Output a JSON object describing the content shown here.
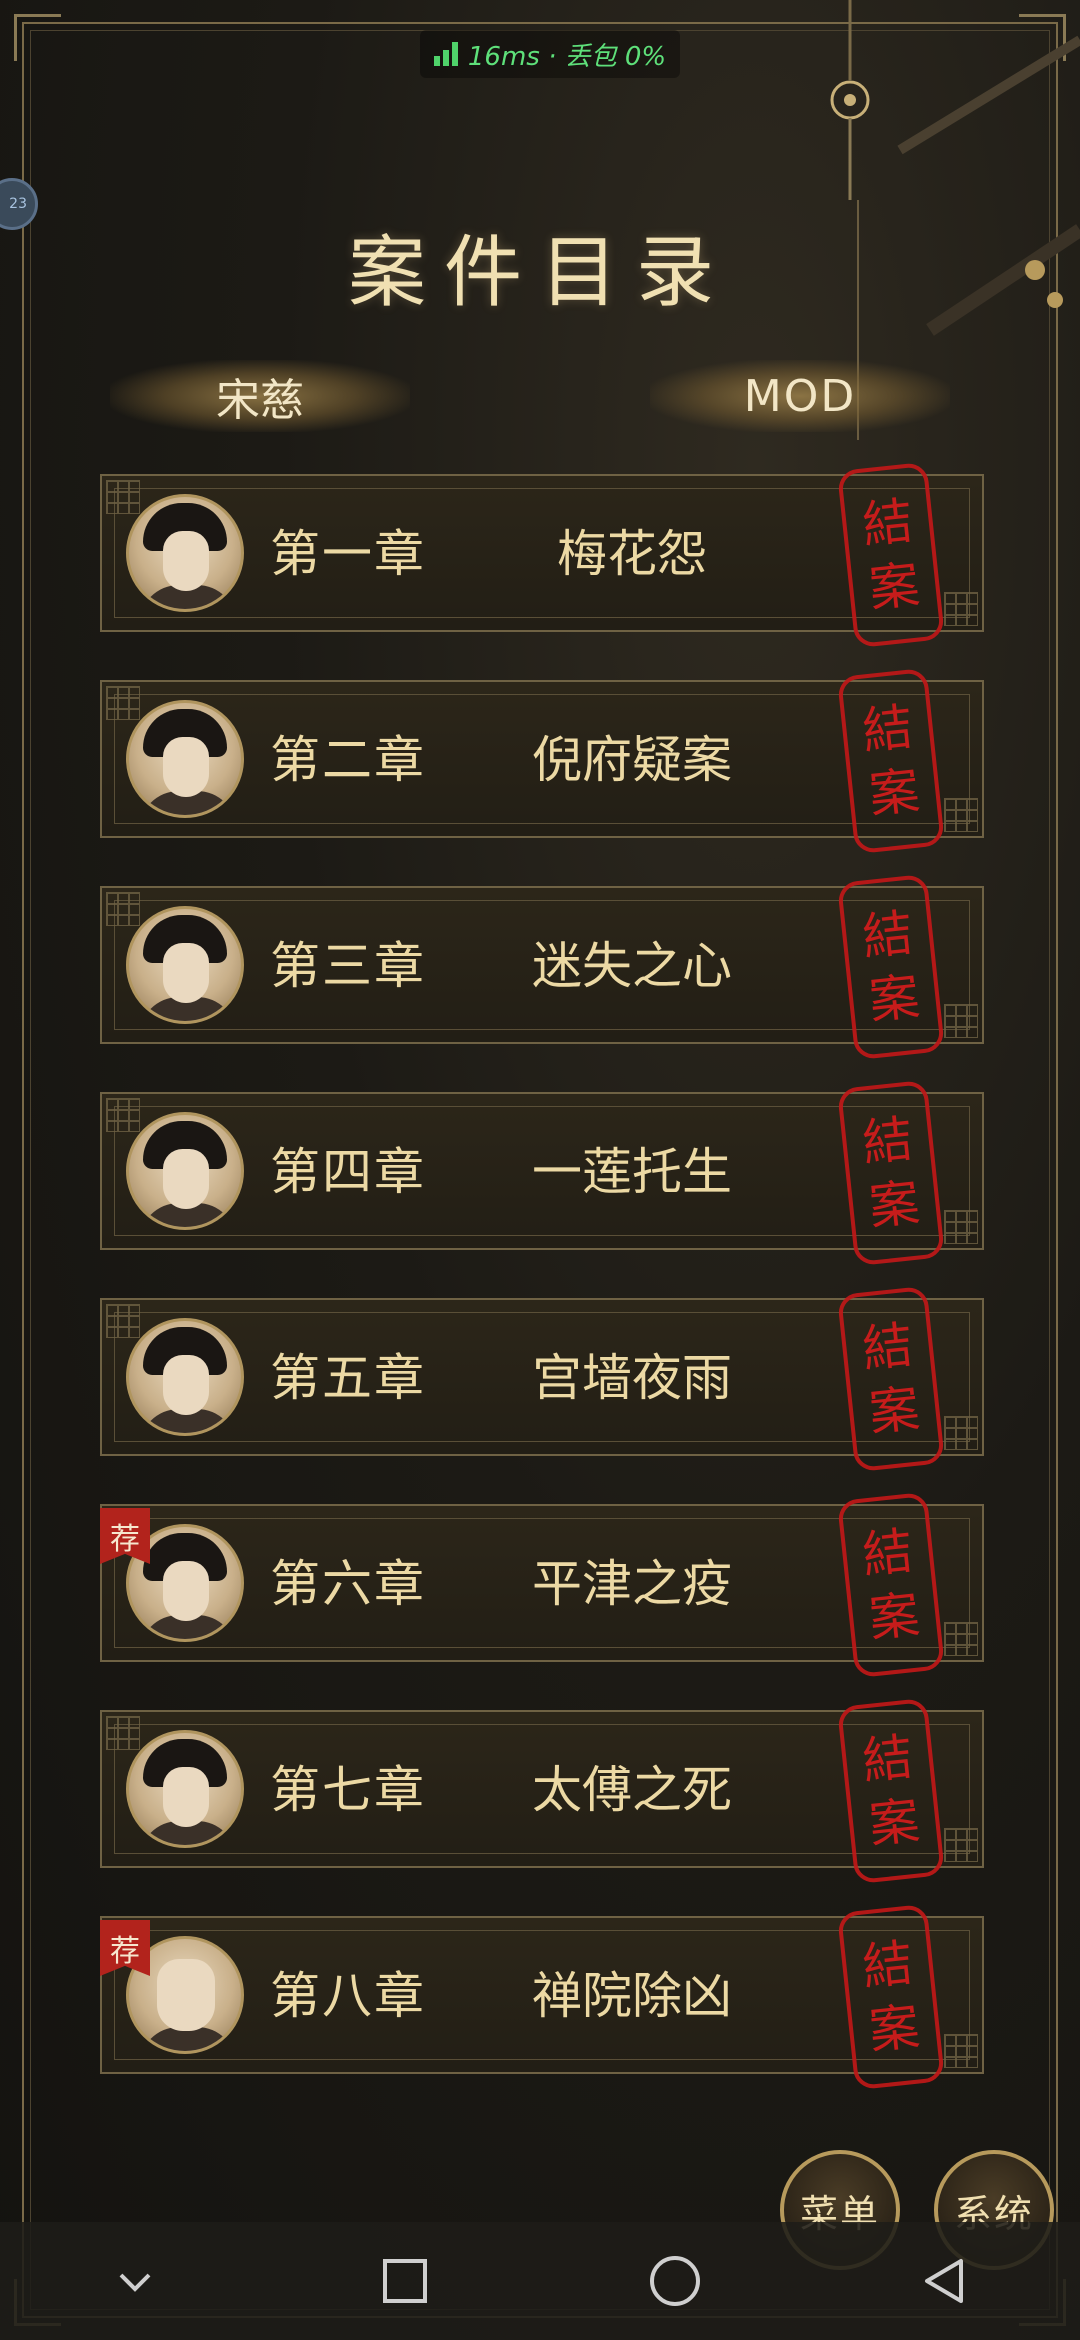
{
  "status": {
    "ping_text": "16ms · 丢包 0%",
    "ping_color": "#5ee07a"
  },
  "title": "案件目录",
  "tabs": [
    {
      "label": "宋慈"
    },
    {
      "label": "MOD"
    }
  ],
  "chapters": [
    {
      "number": "第一章",
      "name": "梅花怨",
      "seal": [
        "結",
        "案"
      ],
      "recommended": false
    },
    {
      "number": "第二章",
      "name": "倪府疑案",
      "seal": [
        "結",
        "案"
      ],
      "recommended": false
    },
    {
      "number": "第三章",
      "name": "迷失之心",
      "seal": [
        "結",
        "案"
      ],
      "recommended": false
    },
    {
      "number": "第四章",
      "name": "一莲托生",
      "seal": [
        "結",
        "案"
      ],
      "recommended": false
    },
    {
      "number": "第五章",
      "name": "宫墙夜雨",
      "seal": [
        "結",
        "案"
      ],
      "recommended": false
    },
    {
      "number": "第六章",
      "name": "平津之疫",
      "seal": [
        "結",
        "案"
      ],
      "recommended": true
    },
    {
      "number": "第七章",
      "name": "太傅之死",
      "seal": [
        "結",
        "案"
      ],
      "recommended": false
    },
    {
      "number": "第八章",
      "name": "禅院除凶",
      "seal": [
        "結",
        "案"
      ],
      "recommended": true
    }
  ],
  "recommend_label": "荐",
  "buttons": {
    "menu": "菜单",
    "system": "系统"
  },
  "side_bubble": "23",
  "colors": {
    "accent_gold": "#ecd9a4",
    "seal_red": "#d41c1c",
    "recommend_red": "#b2231c"
  },
  "navbar": {
    "icons": [
      "chevron-down-icon",
      "recent-apps-icon",
      "home-icon",
      "back-icon"
    ]
  }
}
